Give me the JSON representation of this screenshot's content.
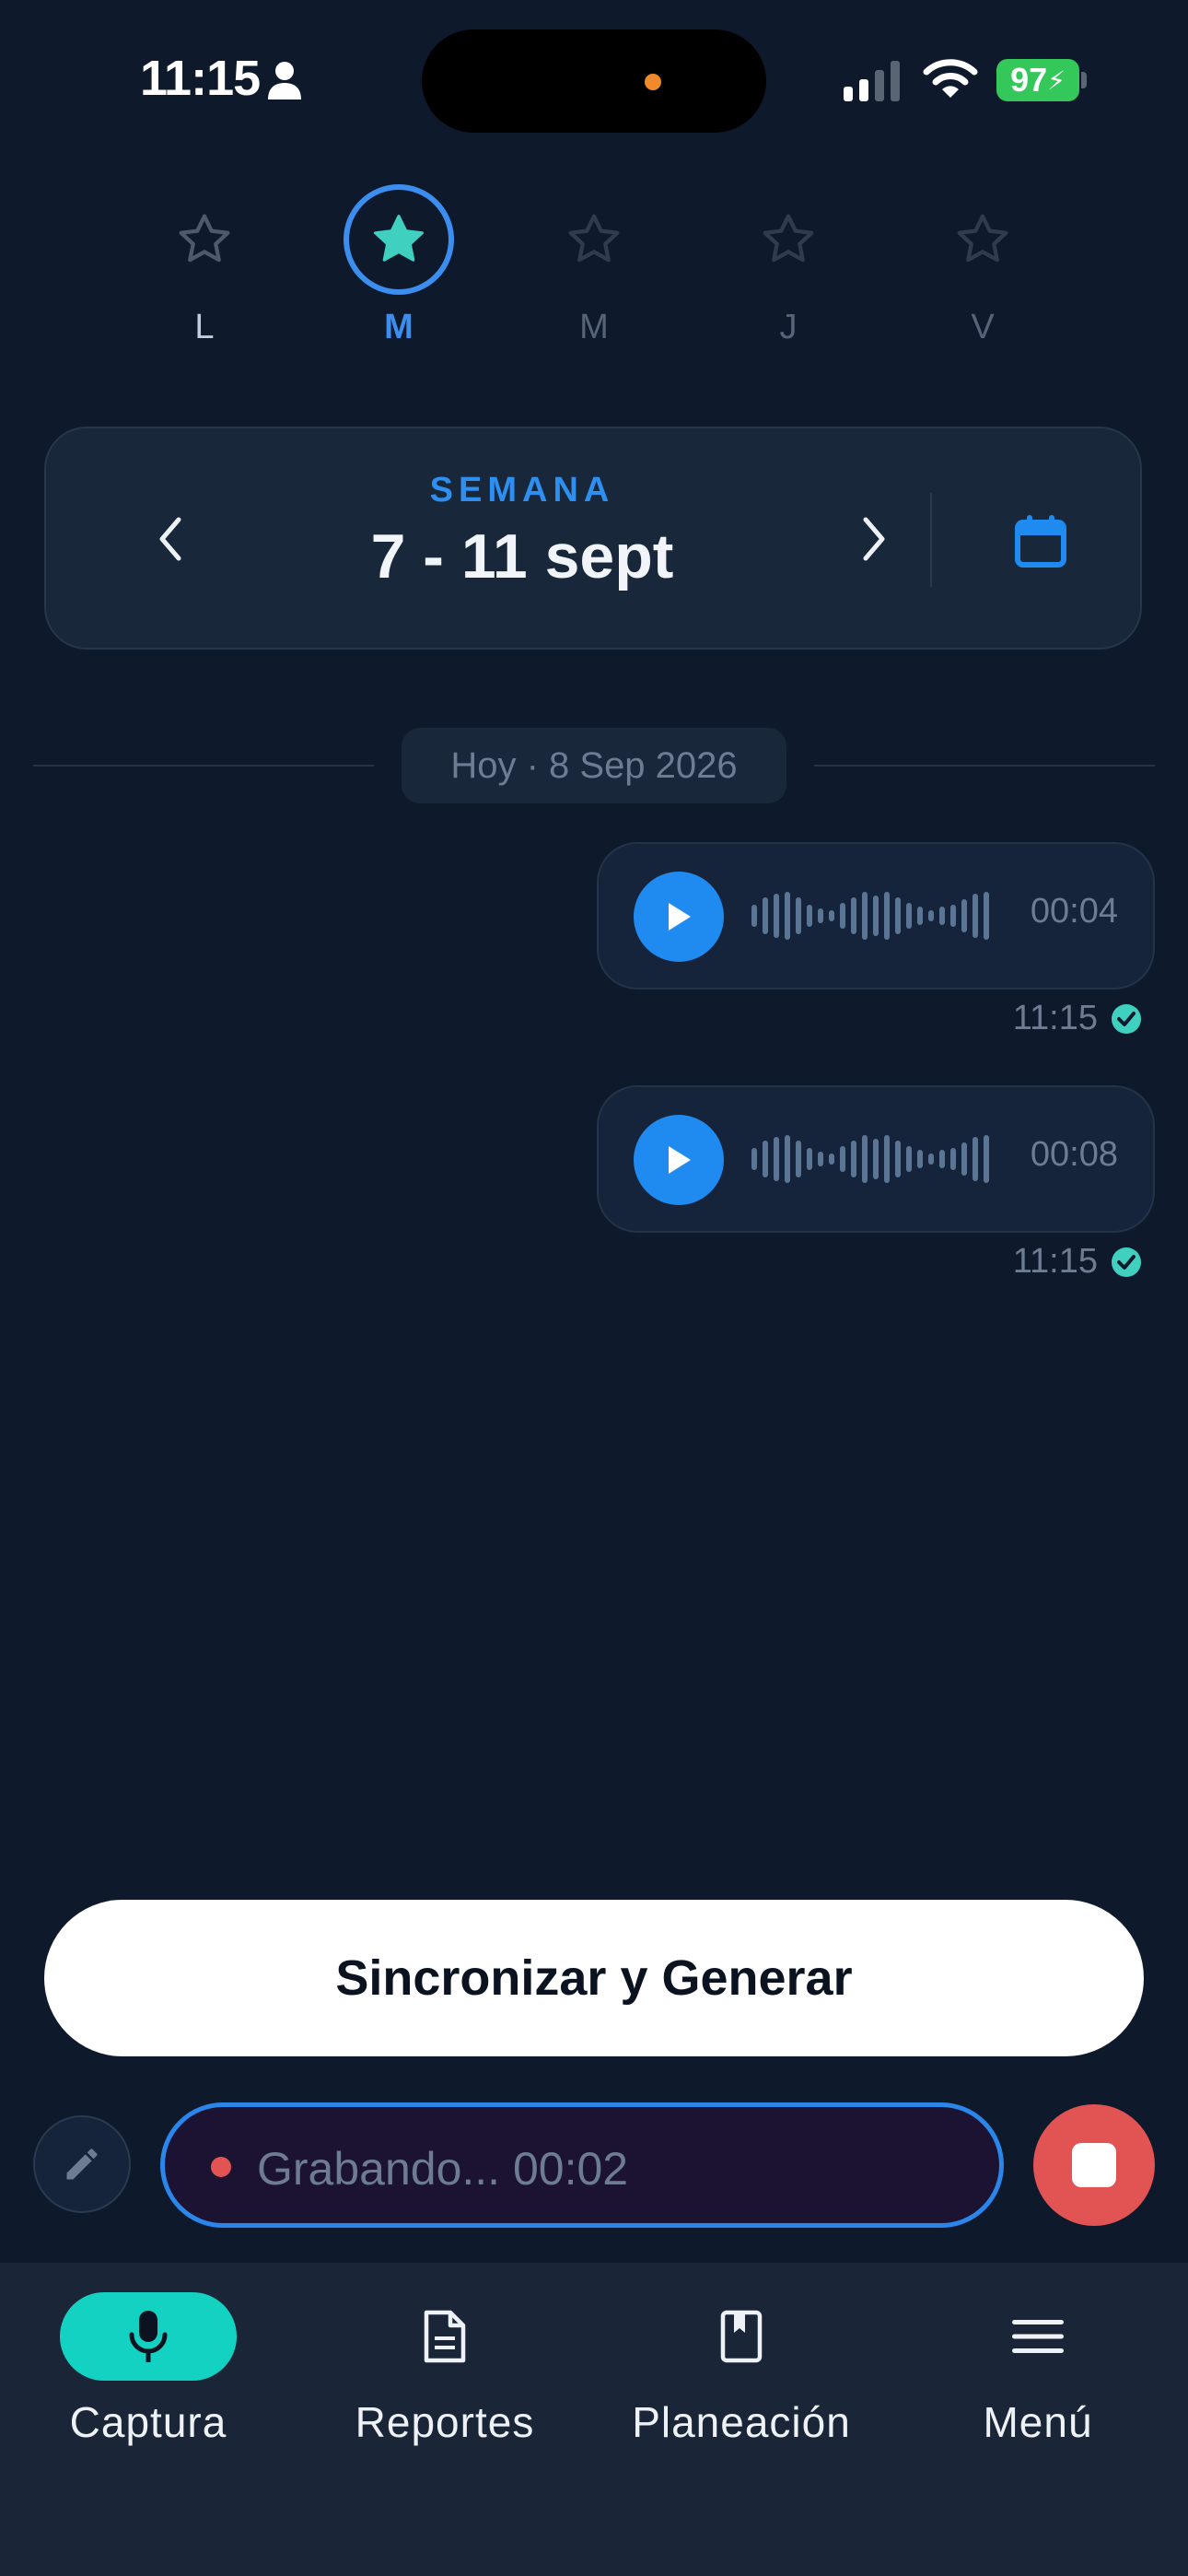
{
  "status_bar": {
    "time": "11:15",
    "battery": "97",
    "icons": [
      "person-icon",
      "signal-icon",
      "wifi-icon",
      "battery-icon"
    ]
  },
  "days": [
    {
      "label": "L",
      "icon": "star-outline-icon",
      "state": "default"
    },
    {
      "label": "M",
      "icon": "star-filled-icon",
      "state": "selected"
    },
    {
      "label": "M",
      "icon": "star-outline-icon",
      "state": "dimmed"
    },
    {
      "label": "J",
      "icon": "star-outline-icon",
      "state": "dimmed"
    },
    {
      "label": "V",
      "icon": "star-outline-icon",
      "state": "dimmed"
    }
  ],
  "week": {
    "label": "SEMANA",
    "range": "7 - 11 sept"
  },
  "date_separator": "Hoy · 8 Sep 2026",
  "messages": [
    {
      "duration": "00:04",
      "time": "11:15",
      "status": "sent"
    },
    {
      "duration": "00:08",
      "time": "11:15",
      "status": "sent"
    }
  ],
  "sync_button": "Sincronizar y Generar",
  "recording": {
    "text": "Grabando... 00:02"
  },
  "nav": [
    {
      "label": "Captura",
      "icon": "microphone-icon",
      "active": true
    },
    {
      "label": "Reportes",
      "icon": "document-icon",
      "active": false
    },
    {
      "label": "Planeación",
      "icon": "book-icon",
      "active": false
    },
    {
      "label": "Menú",
      "icon": "menu-icon",
      "active": false
    }
  ],
  "colors": {
    "background": "#0e1a2b",
    "accent_blue": "#1f8af0",
    "accent_teal": "#14d2c2",
    "record_red": "#e25454"
  }
}
